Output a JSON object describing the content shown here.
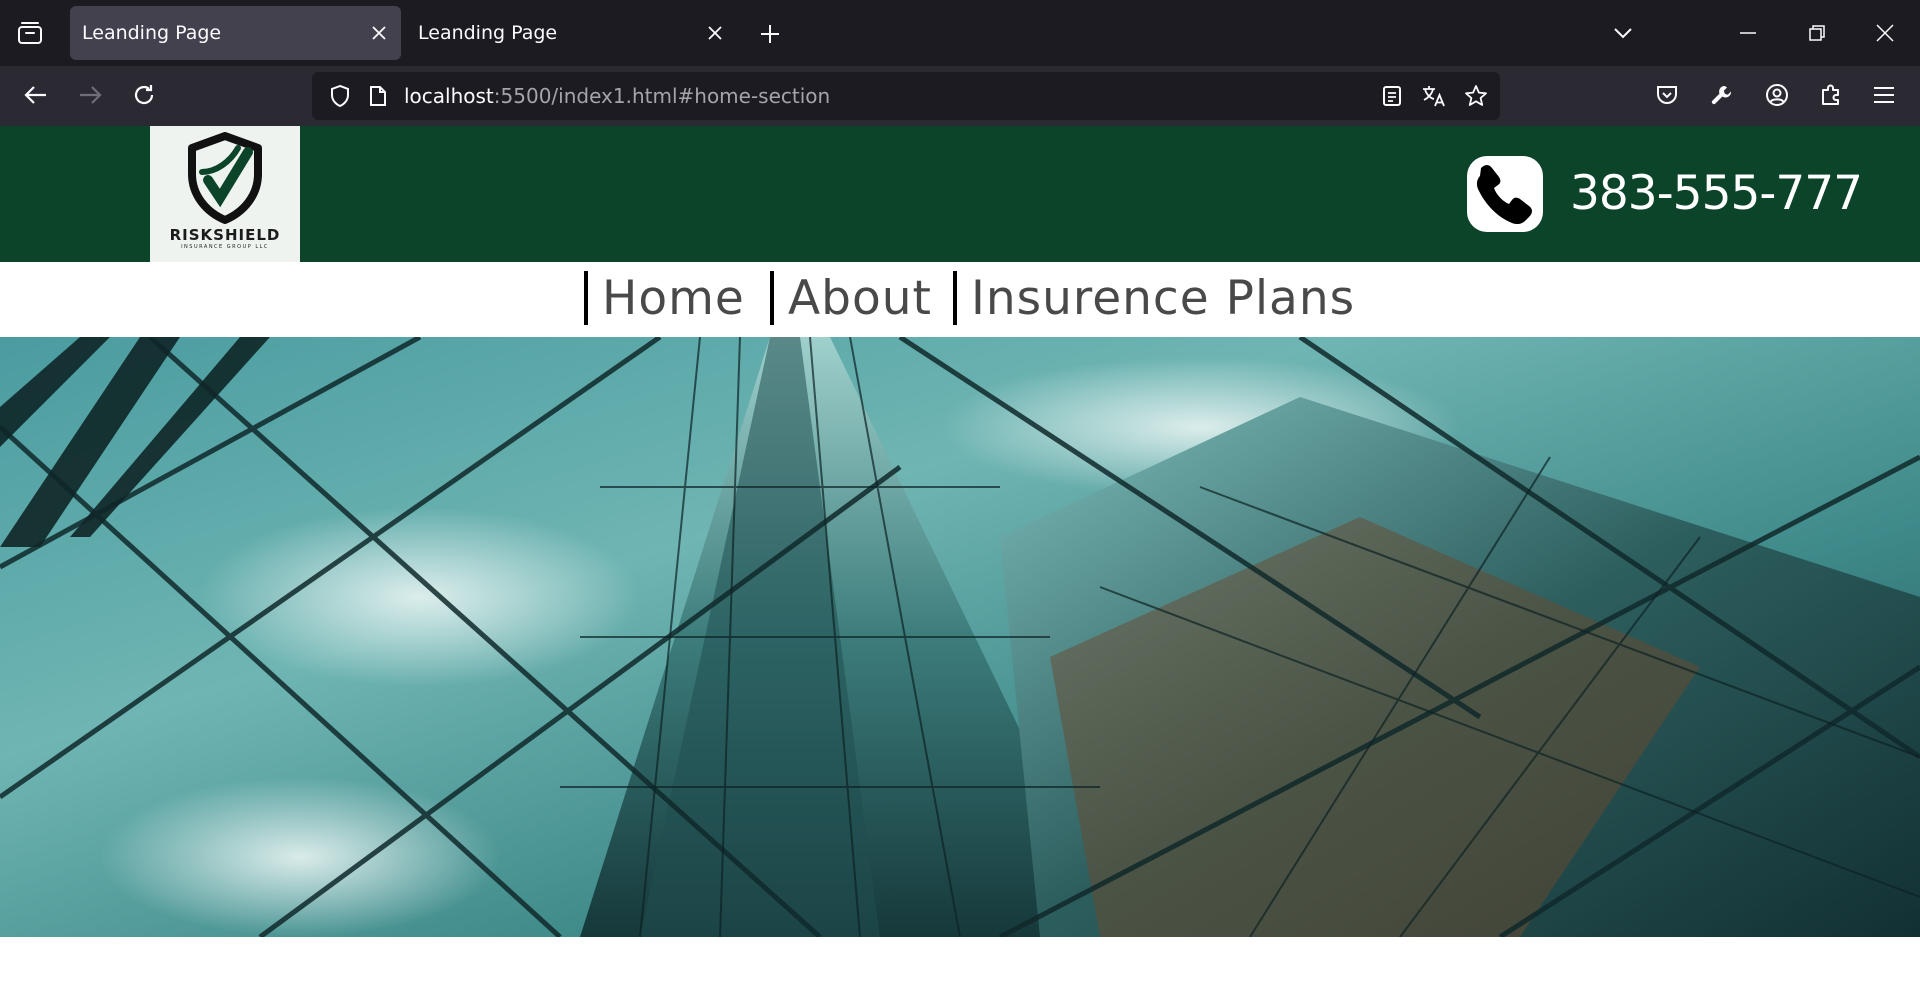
{
  "browser": {
    "tabs": [
      {
        "title": "Leanding Page",
        "active": true
      },
      {
        "title": "Leanding Page",
        "active": false
      }
    ],
    "url": {
      "host": "localhost",
      "rest": ":5500/index1.html#home-section"
    }
  },
  "site": {
    "logo": {
      "name": "RISKSHIELD",
      "tagline": "INSURANCE GROUP LLC"
    },
    "phone": "383-555-777",
    "nav": [
      {
        "label": "Home"
      },
      {
        "label": "About"
      },
      {
        "label": "Insurence Plans"
      }
    ]
  },
  "colors": {
    "header_green": "#0b4428",
    "chrome_dark": "#1c1b22",
    "chrome_toolbar": "#2b2a33"
  }
}
